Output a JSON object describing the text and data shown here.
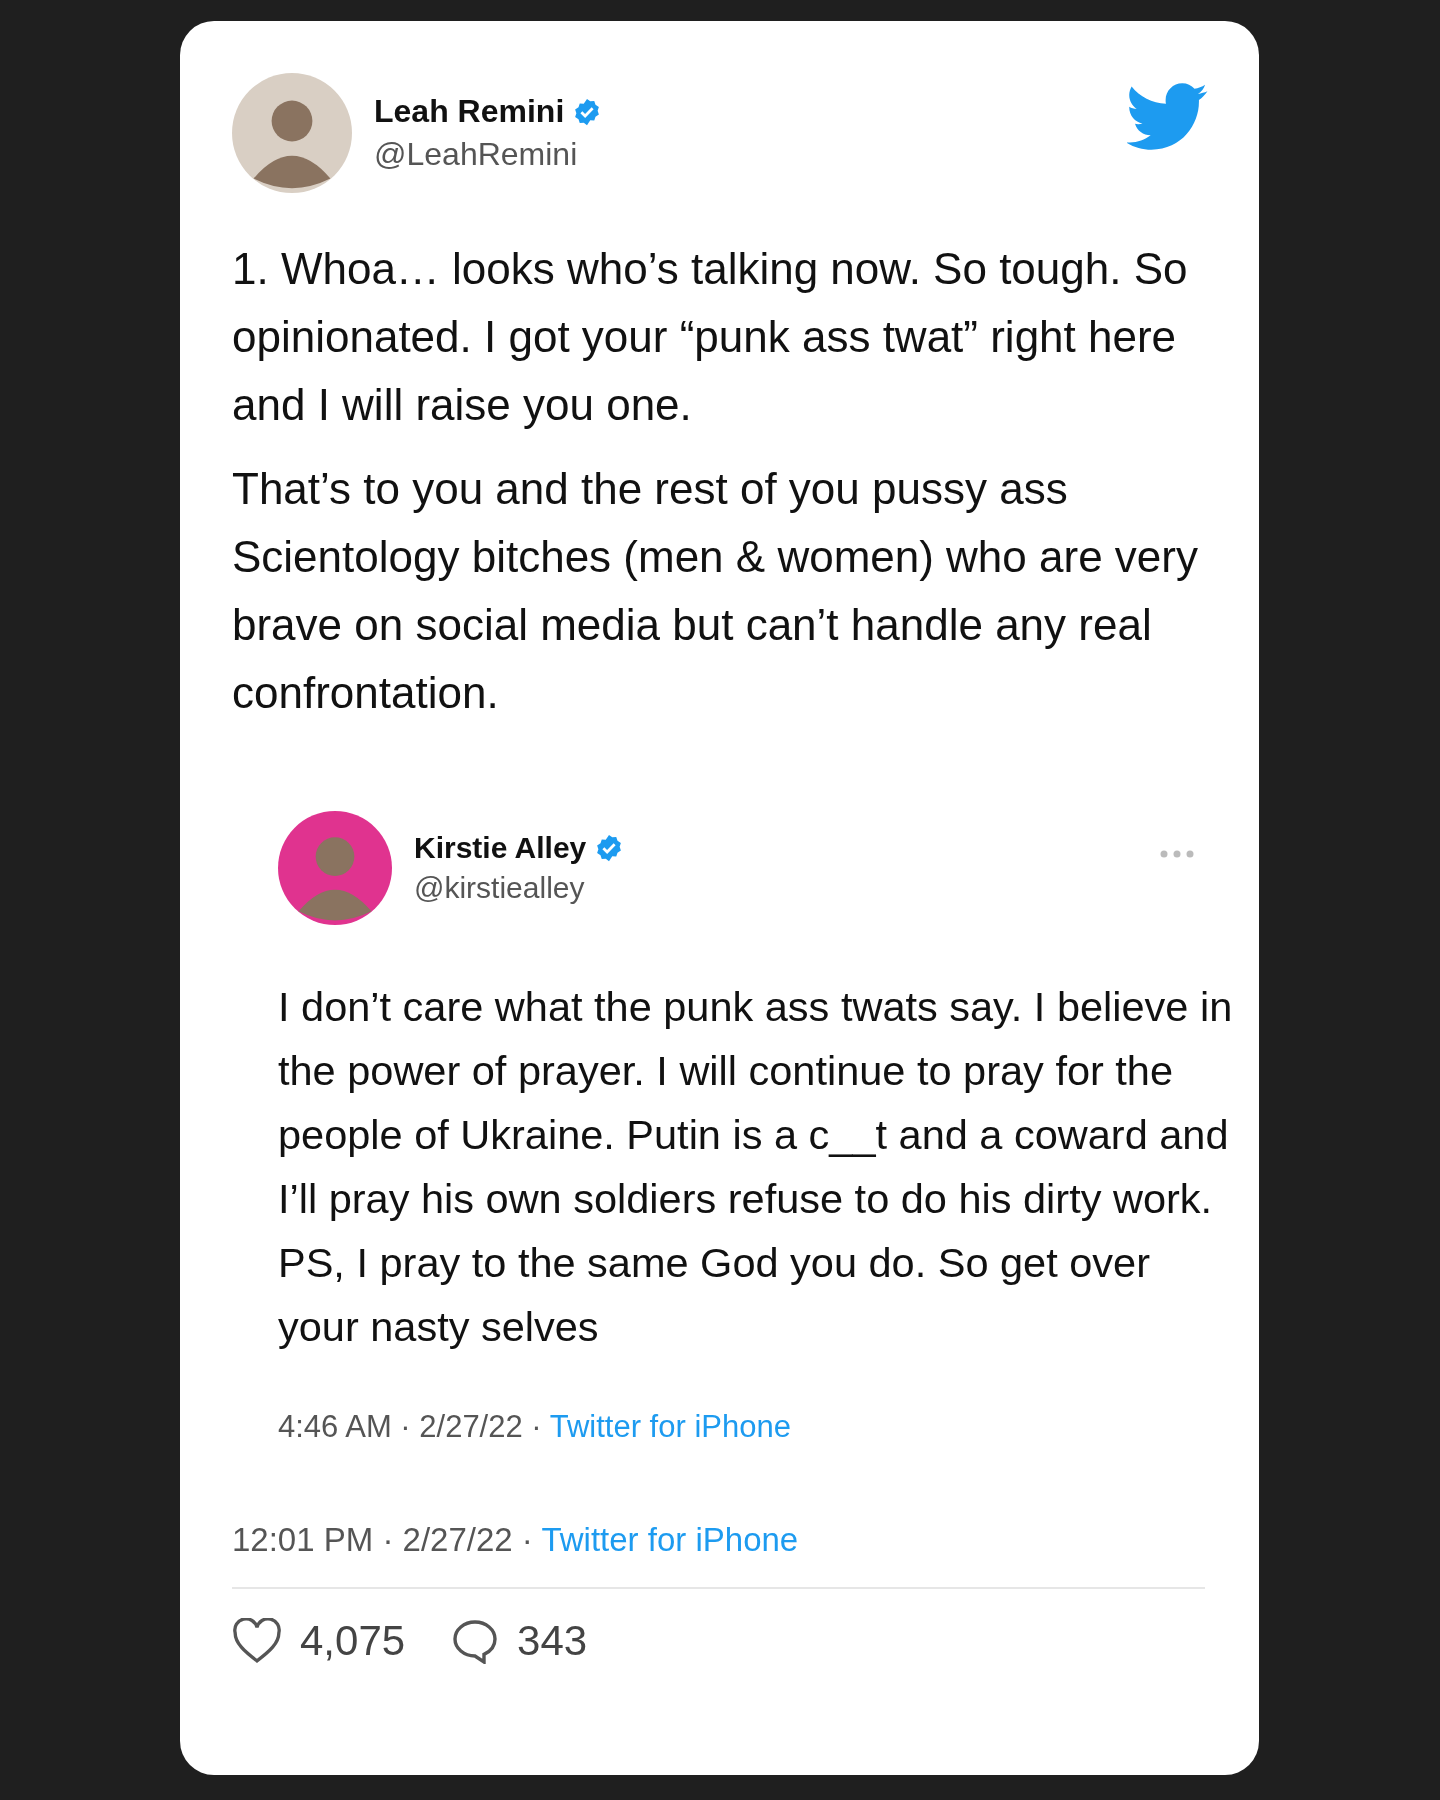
{
  "tweet": {
    "author": {
      "name": "Leah Remini",
      "handle": "@LeahRemini",
      "verified": true
    },
    "paragraphs": [
      "1. Whoa… looks who’s talking now. So tough. So opinionated. I got your “punk ass twat” right here and I will raise you one.",
      "That’s to you and the rest of you pussy ass Scientology bitches (men & women) who are very brave on social media but can’t handle any real confrontation."
    ],
    "quoted": {
      "author": {
        "name": "Kirstie Alley",
        "handle": "@kirstiealley",
        "verified": true
      },
      "text": "I don’t care what the punk ass twats say. I believe in the power of prayer. I will continue to pray for the people of Ukraine. Putin is a c__t and a coward and I’ll pray his own soldiers refuse to do his dirty work. PS, I pray to the same God you do. So get over your nasty selves",
      "timestamp": "4:46 AM · 2/27/22 ·",
      "source": "Twitter for iPhone"
    },
    "timestamp": "12:01 PM · 2/27/22 ·",
    "source": "Twitter for iPhone",
    "likes": "4,075",
    "replies": "343"
  }
}
